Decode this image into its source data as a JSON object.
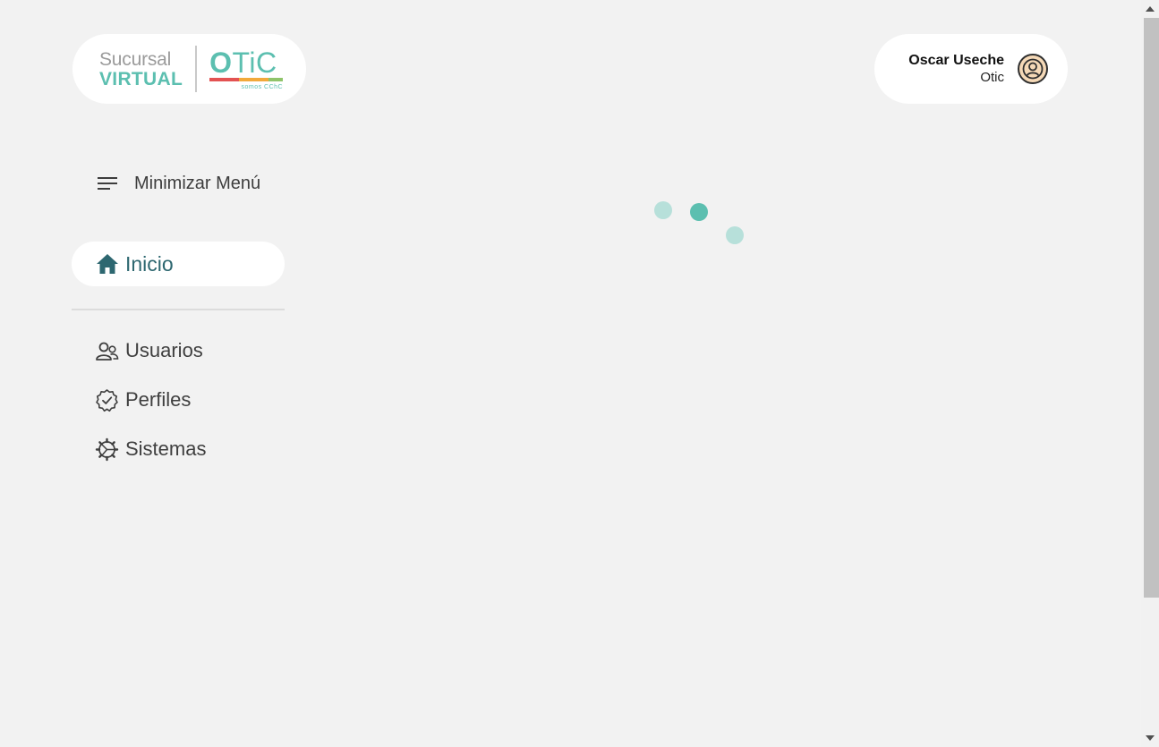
{
  "logo": {
    "line1": "Sucursal",
    "line2": "VIRTUAL",
    "brand_o": "O",
    "brand_rest": "TiC",
    "tagline": "somos CChC",
    "bar_colors": [
      "#e35252",
      "#e35252",
      "#f2a93b",
      "#f2a93b",
      "#8fc46a"
    ]
  },
  "user": {
    "name": "Oscar Useche",
    "role": "Otic",
    "avatar_icon": "user-circle-icon"
  },
  "sidebar": {
    "minimize_label": "Minimizar Menú",
    "minimize_icon": "menu-lines-icon",
    "active_item": {
      "label": "Inicio",
      "icon": "home-icon"
    },
    "items": [
      {
        "label": "Usuarios",
        "icon": "users-icon"
      },
      {
        "label": "Perfiles",
        "icon": "badge-check-icon"
      },
      {
        "label": "Sistemas",
        "icon": "gear-icon"
      }
    ]
  },
  "loader": {
    "dot_colors": [
      "#b7e0da",
      "#5cbfb0",
      "#b7e0da"
    ]
  },
  "colors": {
    "background": "#f2f2f2",
    "accent_teal": "#5cbfb0",
    "active_text": "#2d6770"
  }
}
